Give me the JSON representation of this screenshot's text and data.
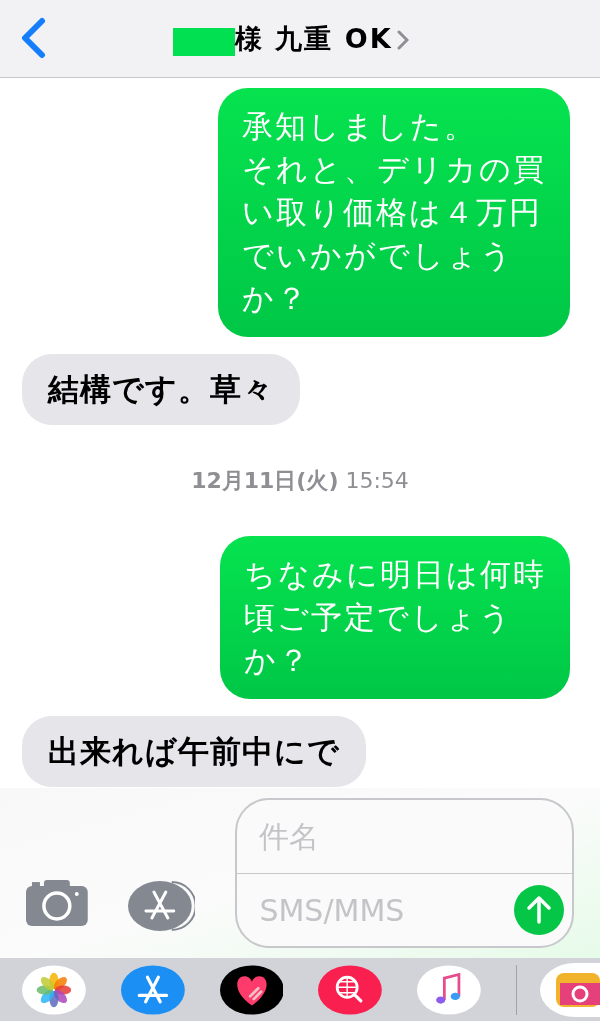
{
  "header": {
    "title": "様 九重 OK"
  },
  "messages": [
    {
      "kind": "sent",
      "lines": [
        "承知しました。",
        "それと、デリカの買",
        "い取り価格は４万円",
        "でいかがでしょう",
        "か？"
      ]
    },
    {
      "kind": "received",
      "text": "結構です。草々"
    },
    {
      "kind": "timestamp",
      "text": "**12月11日(火)** 15:54"
    },
    {
      "kind": "sent",
      "lines": [
        "ちなみに明日は何時",
        "頃ご予定でしょう",
        "か？"
      ]
    },
    {
      "kind": "received",
      "text": "出来れば午前中にで"
    }
  ],
  "compose": {
    "subject_placeholder": "件名",
    "message_placeholder": "SMS/MMS"
  }
}
